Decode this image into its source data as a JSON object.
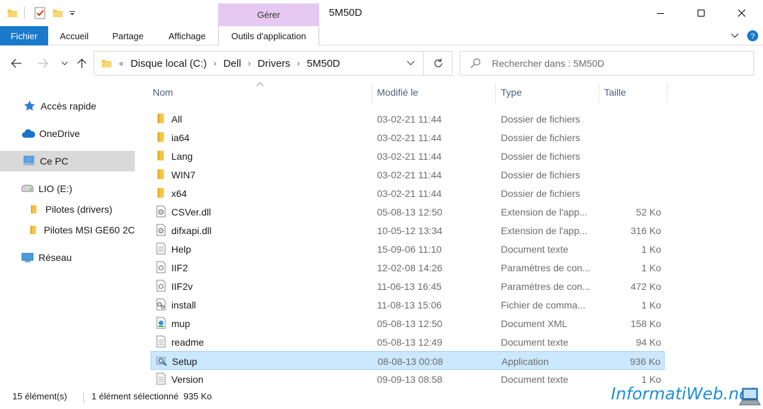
{
  "window": {
    "title": "5M50D",
    "context_tab": "Gérer"
  },
  "ribbon": {
    "tabs": [
      "Fichier",
      "Accueil",
      "Partage",
      "Affichage",
      "Outils d'application"
    ]
  },
  "address": {
    "prefix": "«",
    "crumbs": [
      "Disque local (C:)",
      "Dell",
      "Drivers",
      "5M50D"
    ],
    "search_placeholder": "Rechercher dans : 5M50D"
  },
  "sidebar": {
    "items": [
      {
        "label": "Accès rapide",
        "icon": "star-icon"
      },
      {
        "label": "OneDrive",
        "icon": "cloud-icon"
      },
      {
        "label": "Ce PC",
        "icon": "computer-icon",
        "selected": true
      },
      {
        "label": "LIO (E:)",
        "icon": "drive-icon"
      },
      {
        "label": "Pilotes (drivers)",
        "icon": "folder-icon"
      },
      {
        "label": "Pilotes MSI GE60 2C",
        "icon": "folder-icon"
      },
      {
        "label": "Réseau",
        "icon": "network-icon"
      }
    ]
  },
  "columns": {
    "name": "Nom",
    "modified": "Modifié le",
    "type": "Type",
    "size": "Taille"
  },
  "files": [
    {
      "name": "All",
      "date": "03-02-21 11:44",
      "type": "Dossier de fichiers",
      "size": "",
      "icon": "folder-icon"
    },
    {
      "name": "ia64",
      "date": "03-02-21 11:44",
      "type": "Dossier de fichiers",
      "size": "",
      "icon": "folder-icon"
    },
    {
      "name": "Lang",
      "date": "03-02-21 11:44",
      "type": "Dossier de fichiers",
      "size": "",
      "icon": "folder-icon"
    },
    {
      "name": "WIN7",
      "date": "03-02-21 11:44",
      "type": "Dossier de fichiers",
      "size": "",
      "icon": "folder-icon"
    },
    {
      "name": "x64",
      "date": "03-02-21 11:44",
      "type": "Dossier de fichiers",
      "size": "",
      "icon": "folder-icon"
    },
    {
      "name": "CSVer.dll",
      "date": "05-08-13 12:50",
      "type": "Extension de l'app...",
      "size": "52 Ko",
      "icon": "dll-icon"
    },
    {
      "name": "difxapi.dll",
      "date": "10-05-12 13:34",
      "type": "Extension de l'app...",
      "size": "316 Ko",
      "icon": "dll-icon"
    },
    {
      "name": "Help",
      "date": "15-09-06 11:10",
      "type": "Document texte",
      "size": "1 Ko",
      "icon": "text-file-icon"
    },
    {
      "name": "IIF2",
      "date": "12-02-08 14:26",
      "type": "Paramètres de con...",
      "size": "1 Ko",
      "icon": "settings-file-icon"
    },
    {
      "name": "IIF2v",
      "date": "11-06-13 16:45",
      "type": "Paramètres de con...",
      "size": "472 Ko",
      "icon": "settings-file-icon"
    },
    {
      "name": "install",
      "date": "11-08-13 15:06",
      "type": "Fichier de comma...",
      "size": "1 Ko",
      "icon": "batch-file-icon"
    },
    {
      "name": "mup",
      "date": "05-08-13 12:50",
      "type": "Document XML",
      "size": "158 Ko",
      "icon": "xml-file-icon"
    },
    {
      "name": "readme",
      "date": "05-08-13 12:49",
      "type": "Document texte",
      "size": "94 Ko",
      "icon": "text-file-icon"
    },
    {
      "name": "Setup",
      "date": "08-08-13 00:08",
      "type": "Application",
      "size": "936 Ko",
      "icon": "setup-app-icon",
      "selected": true
    },
    {
      "name": "Version",
      "date": "09-09-13 08:58",
      "type": "Document texte",
      "size": "1 Ko",
      "icon": "text-file-icon"
    }
  ],
  "status": {
    "count": "15 élément(s)",
    "selection": "1 élément sélectionné  935 Ko"
  },
  "watermark": "InformatiWeb.net",
  "colors": {
    "accent": "#1979ca",
    "context_tab": "#e6c9f2",
    "selection": "#cce8ff",
    "folder": "#f4c542"
  }
}
